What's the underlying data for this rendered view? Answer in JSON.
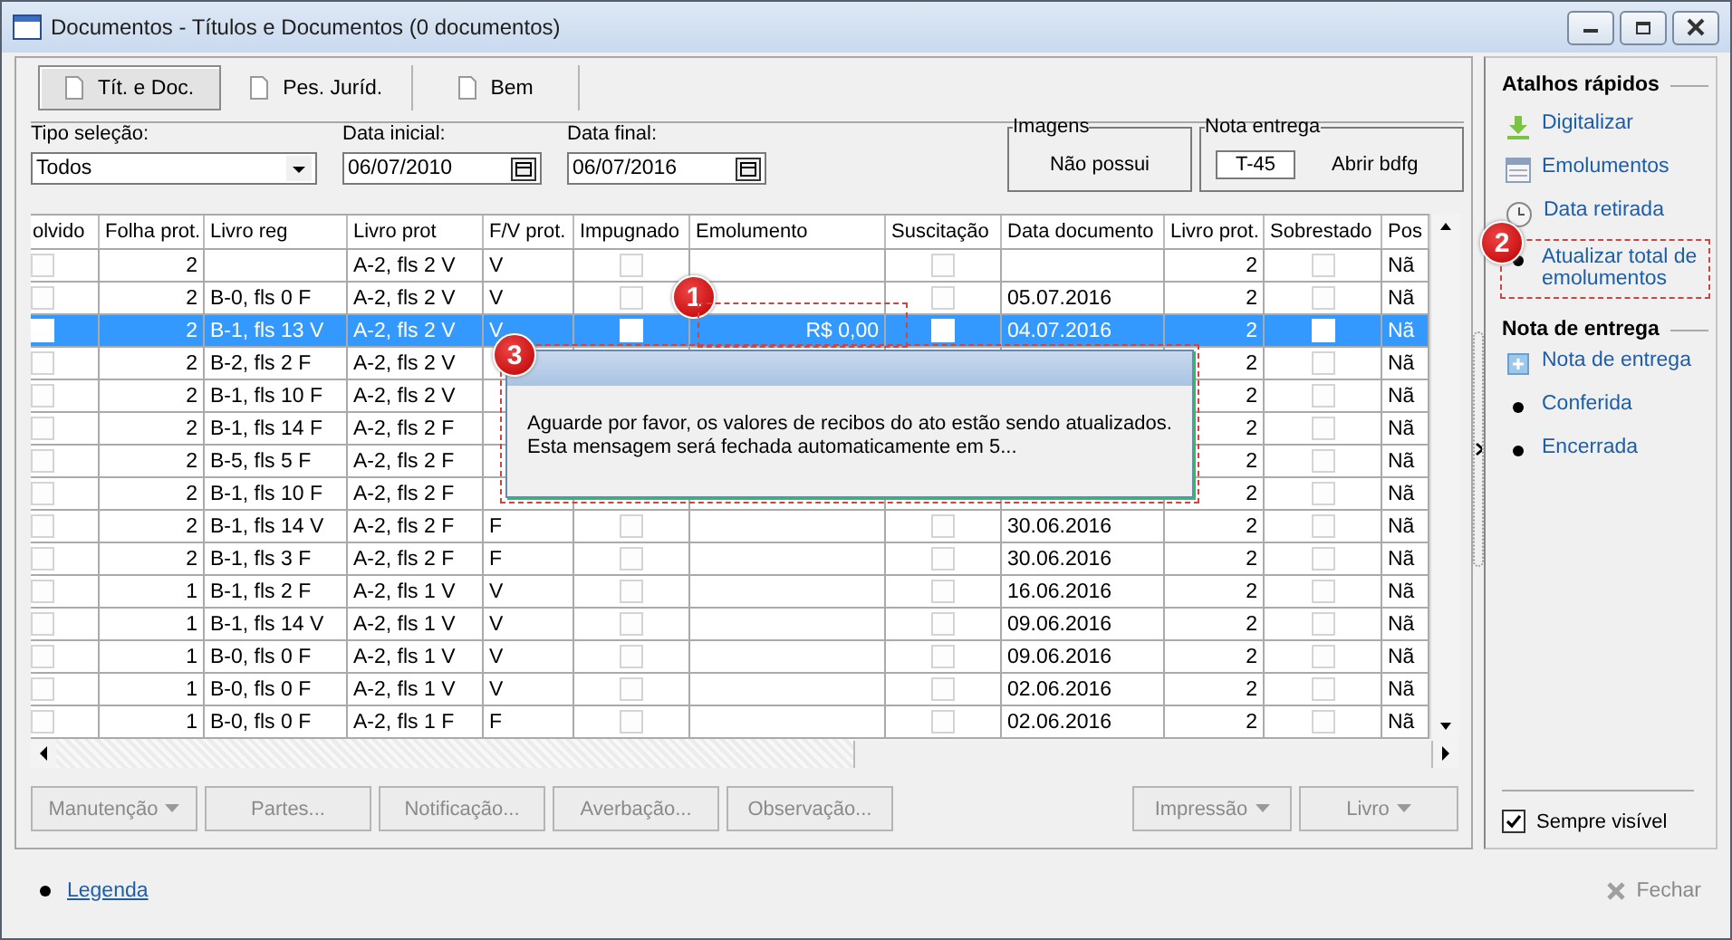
{
  "window": {
    "title": "Documentos - Títulos e Documentos (0 documentos)"
  },
  "tabs": [
    {
      "label": "Tít. e Doc.",
      "selected": true
    },
    {
      "label": "Pes. Juríd.",
      "selected": false
    },
    {
      "label": "Bem",
      "selected": false
    }
  ],
  "filters": [
    {
      "kind": "select",
      "label": "Tipo seleção:",
      "value": "Todos"
    },
    {
      "kind": "date",
      "label": "Data inicial:",
      "value": "06/07/2010"
    },
    {
      "kind": "date",
      "label": "Data final:",
      "value": "06/07/2016"
    }
  ],
  "imagens": {
    "legend": "Imagens",
    "text": "Não possui"
  },
  "nota_entrega": {
    "legend": "Nota entrega",
    "value": "T-45",
    "text": "Abrir bdfg"
  },
  "table": {
    "columns": [
      {
        "label": "olvido",
        "kind": "check"
      },
      {
        "label": "Folha prot.",
        "kind": "number"
      },
      {
        "label": "Livro reg",
        "kind": "text"
      },
      {
        "label": "Livro prot",
        "kind": "text"
      },
      {
        "label": "F/V prot.",
        "kind": "text"
      },
      {
        "label": "Impugnado",
        "kind": "check"
      },
      {
        "label": "Emolumento",
        "kind": "number"
      },
      {
        "label": "Suscitação",
        "kind": "check"
      },
      {
        "label": "Data documento",
        "kind": "text"
      },
      {
        "label": "Livro prot.",
        "kind": "number"
      },
      {
        "label": "Sobrestado",
        "kind": "check"
      },
      {
        "label": "Pos",
        "kind": "text"
      }
    ],
    "rows": [
      {
        "selected": false,
        "cells": [
          false,
          "2",
          "",
          "A-2, fls 2 V",
          "V",
          false,
          "",
          false,
          "",
          "2",
          false,
          "Nã"
        ]
      },
      {
        "selected": false,
        "cells": [
          false,
          "2",
          "B-0, fls 0 F",
          "A-2, fls 2 V",
          "V",
          false,
          "",
          false,
          "05.07.2016",
          "2",
          false,
          "Nã"
        ]
      },
      {
        "selected": true,
        "cells": [
          false,
          "2",
          "B-1, fls 13 V",
          "A-2, fls 2 V",
          "V",
          false,
          "R$ 0,00",
          false,
          "04.07.2016",
          "2",
          false,
          "Nã"
        ]
      },
      {
        "selected": false,
        "cells": [
          false,
          "2",
          "B-2, fls 2 F",
          "A-2, fls 2 V",
          null,
          null,
          null,
          null,
          null,
          "2",
          false,
          "Nã"
        ]
      },
      {
        "selected": false,
        "cells": [
          false,
          "2",
          "B-1, fls 10 F",
          "A-2, fls 2 V",
          null,
          null,
          null,
          null,
          null,
          "2",
          false,
          "Nã"
        ]
      },
      {
        "selected": false,
        "cells": [
          false,
          "2",
          "B-1, fls 14 F",
          "A-2, fls 2 F",
          null,
          null,
          null,
          null,
          null,
          "2",
          false,
          "Nã"
        ]
      },
      {
        "selected": false,
        "cells": [
          false,
          "2",
          "B-5, fls 5 F",
          "A-2, fls 2 F",
          null,
          null,
          null,
          null,
          null,
          "2",
          false,
          "Nã"
        ]
      },
      {
        "selected": false,
        "cells": [
          false,
          "2",
          "B-1, fls 10 F",
          "A-2, fls 2 F",
          null,
          null,
          null,
          null,
          null,
          "2",
          false,
          "Nã"
        ]
      },
      {
        "selected": false,
        "cells": [
          false,
          "2",
          "B-1, fls 14 V",
          "A-2, fls 2 F",
          "F",
          false,
          "",
          false,
          "30.06.2016",
          "2",
          false,
          "Nã"
        ]
      },
      {
        "selected": false,
        "cells": [
          false,
          "2",
          "B-1, fls 3 F",
          "A-2, fls 2 F",
          "F",
          false,
          "",
          false,
          "30.06.2016",
          "2",
          false,
          "Nã"
        ]
      },
      {
        "selected": false,
        "cells": [
          false,
          "1",
          "B-1, fls 2 F",
          "A-2, fls 1 V",
          "V",
          false,
          "",
          false,
          "16.06.2016",
          "2",
          false,
          "Nã"
        ]
      },
      {
        "selected": false,
        "cells": [
          false,
          "1",
          "B-1, fls 14 V",
          "A-2, fls 1 V",
          "V",
          false,
          "",
          false,
          "09.06.2016",
          "2",
          false,
          "Nã"
        ]
      },
      {
        "selected": false,
        "cells": [
          false,
          "1",
          "B-0, fls 0 F",
          "A-2, fls 1 V",
          "V",
          false,
          "",
          false,
          "09.06.2016",
          "2",
          false,
          "Nã"
        ]
      },
      {
        "selected": false,
        "cells": [
          false,
          "1",
          "B-0, fls 0 F",
          "A-2, fls 1 V",
          "V",
          false,
          "",
          false,
          "02.06.2016",
          "2",
          false,
          "Nã"
        ]
      },
      {
        "selected": false,
        "cells": [
          false,
          "1",
          "B-0, fls 0 F",
          "A-2, fls 1 F",
          "F",
          false,
          "",
          false,
          "02.06.2016",
          "2",
          false,
          "Nã"
        ]
      }
    ]
  },
  "popup": {
    "lines": [
      "Aguarde por favor, os valores de recibos do ato estão sendo atualizados.",
      "Esta mensagem será fechada automaticamente em 5..."
    ]
  },
  "buttons": [
    {
      "label": "Manutenção",
      "dropdown": true,
      "disabled": true
    },
    {
      "label": "Partes...",
      "dropdown": false,
      "disabled": true
    },
    {
      "label": "Notificação...",
      "dropdown": false,
      "disabled": true
    },
    {
      "label": "Averbação...",
      "dropdown": false,
      "disabled": true
    },
    {
      "label": "Observação...",
      "dropdown": false,
      "disabled": true
    },
    {
      "label": "Impressão",
      "dropdown": true,
      "disabled": true
    },
    {
      "label": "Livro",
      "dropdown": true,
      "disabled": true
    }
  ],
  "shortcuts": {
    "title": "Atalhos rápidos",
    "items": [
      {
        "label": "Digitalizar",
        "kind": "download",
        "highlighted": false
      },
      {
        "label": "Emolumentos",
        "kind": "table",
        "highlighted": false
      },
      {
        "label": "Data retirada",
        "kind": "clock",
        "highlighted": false
      },
      {
        "label": "Atualizar total de emolumentos",
        "kind": "bullet",
        "highlighted": true
      }
    ]
  },
  "delivery": {
    "title": "Nota de entrega",
    "items": [
      {
        "label": "Nota de entrega",
        "kind": "plus"
      },
      {
        "label": "Conferida",
        "kind": "bullet"
      },
      {
        "label": "Encerrada",
        "kind": "bullet"
      }
    ]
  },
  "always_visible": {
    "label": "Sempre visível",
    "checked": true
  },
  "callouts": [
    "1",
    "2",
    "3"
  ],
  "footer": {
    "legend_link": "Legenda",
    "close_button": "Fechar"
  }
}
